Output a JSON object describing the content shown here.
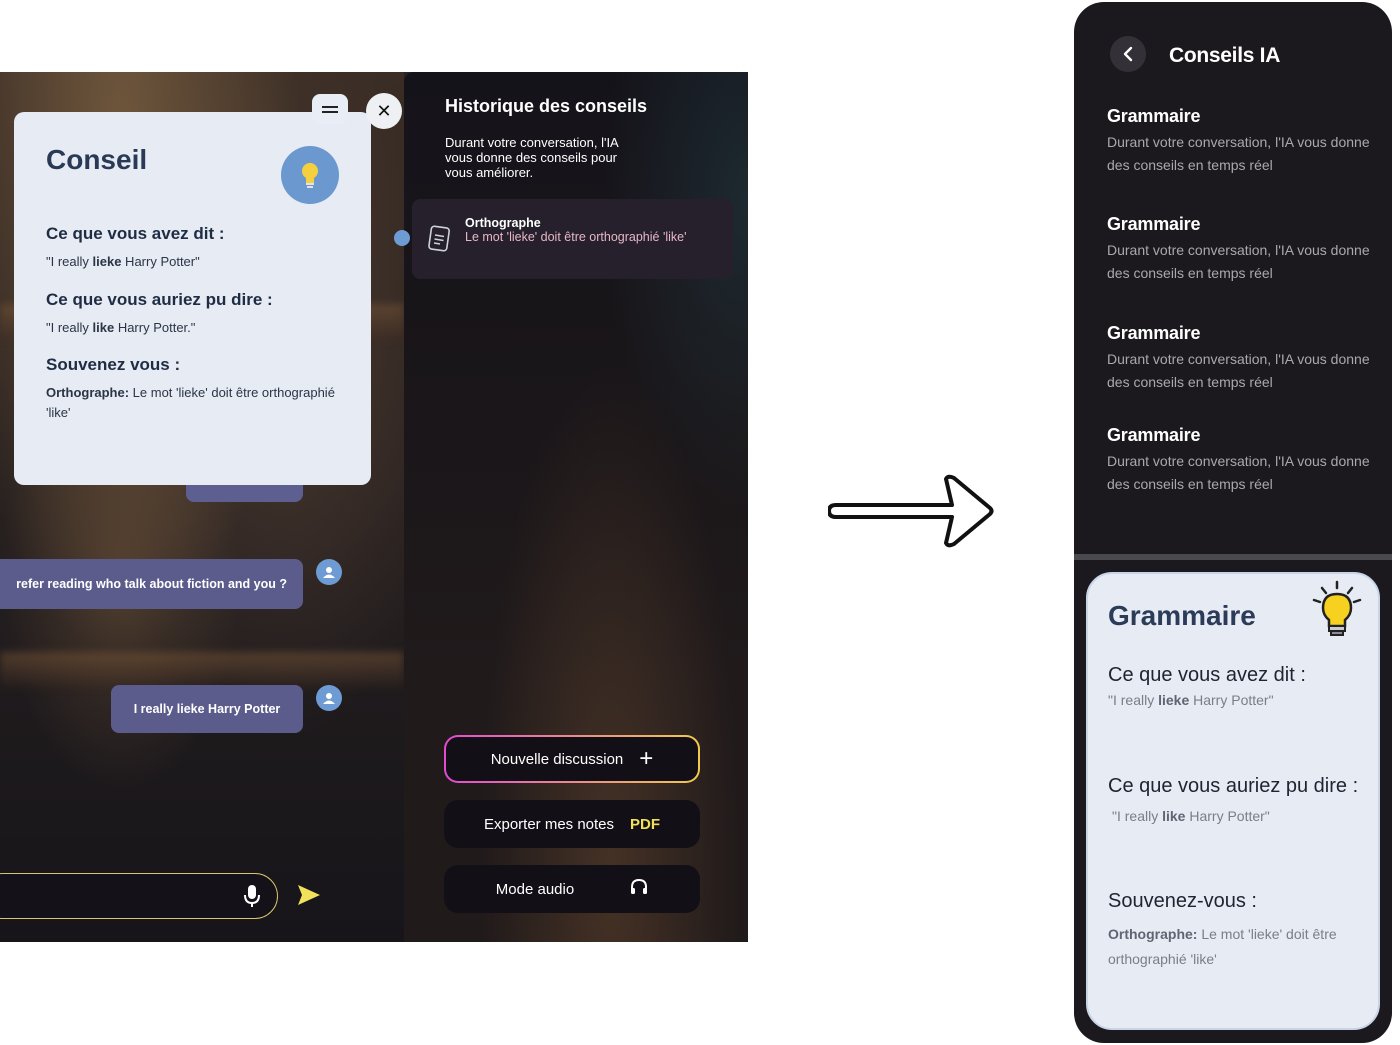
{
  "desktop": {
    "card": {
      "title": "Conseil",
      "said_label": "Ce que vous avez dit :",
      "said_pre": "\"I really ",
      "said_bold": "lieke",
      "said_post": " Harry Potter\"",
      "could_label": "Ce que vous auriez pu dire :",
      "could_pre": "\"I really ",
      "could_bold": "like",
      "could_post": " Harry Potter.\"",
      "remember_label": "Souvenez vous :",
      "remember_bold": "Orthographe:",
      "remember_text": " Le mot 'lieke' doit être orthographié 'like'"
    },
    "messages": [
      "refer reading who talk about fiction and you ?",
      "I really lieke Harry Potter"
    ],
    "history": {
      "title": "Historique des conseils",
      "description": "Durant votre conversation, l'IA vous donne des conseils pour vous améliorer.",
      "item_title": "Orthographe",
      "item_text": "Le mot 'lieke' doit être orthographié 'like'"
    },
    "buttons": {
      "new_discussion": "Nouvelle discussion",
      "new_icon": "+",
      "export": "Exporter mes notes",
      "export_badge": "PDF",
      "audio": "Mode audio"
    },
    "icons": [
      "menu-icon",
      "close-icon",
      "lightbulb-icon",
      "user-icon",
      "document-icon",
      "microphone-icon",
      "send-icon",
      "headphones-icon"
    ]
  },
  "mobile": {
    "title": "Conseils IA",
    "items": [
      {
        "title": "Grammaire",
        "text": "Durant votre conversation, l'IA vous donne des conseils en temps réel"
      },
      {
        "title": "Grammaire",
        "text": "Durant votre conversation, l'IA vous donne des conseils en temps réel"
      },
      {
        "title": "Grammaire",
        "text": "Durant votre conversation, l'IA vous donne des conseils en temps réel"
      },
      {
        "title": "Grammaire",
        "text": "Durant votre conversation, l'IA vous donne des conseils en temps réel"
      }
    ],
    "card": {
      "title": "Grammaire",
      "said_label": "Ce que vous avez dit :",
      "said_pre": "\"I really ",
      "said_bold": "lieke",
      "said_post": " Harry Potter\"",
      "could_label": "Ce que vous auriez pu dire :",
      "could_pre": "\"I really ",
      "could_bold": "like",
      "could_post": " Harry Potter\"",
      "remember_label": "Souvenez-vous :",
      "remember_bold": "Orthographe:",
      "remember_text": " Le mot 'lieke' doit être orthographié 'like'"
    }
  },
  "colors": {
    "accent_blue": "#6f9bd4",
    "bubble": "#5b5c8c",
    "card_bg": "#e6ebf4",
    "pdf_yellow": "#f1e05a"
  }
}
